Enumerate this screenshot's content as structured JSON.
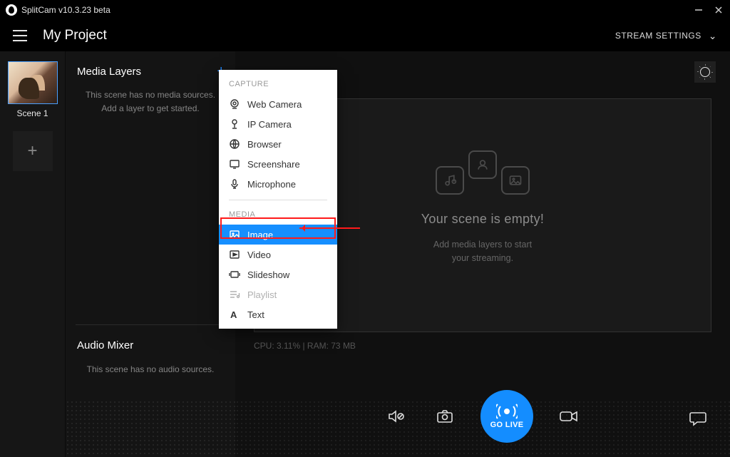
{
  "titlebar": {
    "title": "SplitCam v10.3.23 beta"
  },
  "header": {
    "project": "My Project",
    "stream_settings": "STREAM SETTINGS"
  },
  "scenes": {
    "items": [
      {
        "label": "Scene 1"
      }
    ]
  },
  "layers": {
    "title": "Media Layers",
    "empty": "This scene has no media sources. Add a layer to get started."
  },
  "mixer": {
    "title": "Audio Mixer",
    "empty": "This scene has no audio sources."
  },
  "preview": {
    "empty_title": "Your scene is empty!",
    "empty_sub_1": "Add media layers to start",
    "empty_sub_2": "your streaming.",
    "stats": "CPU: 3.11% | RAM: 73 MB"
  },
  "golive": {
    "label": "GO LIVE"
  },
  "popup": {
    "capture_label": "CAPTURE",
    "media_label": "MEDIA",
    "capture": [
      {
        "label": "Web Camera"
      },
      {
        "label": "IP Camera"
      },
      {
        "label": "Browser"
      },
      {
        "label": "Screenshare"
      },
      {
        "label": "Microphone"
      }
    ],
    "media": [
      {
        "label": "Image"
      },
      {
        "label": "Video"
      },
      {
        "label": "Slideshow"
      },
      {
        "label": "Playlist"
      },
      {
        "label": "Text"
      }
    ]
  }
}
